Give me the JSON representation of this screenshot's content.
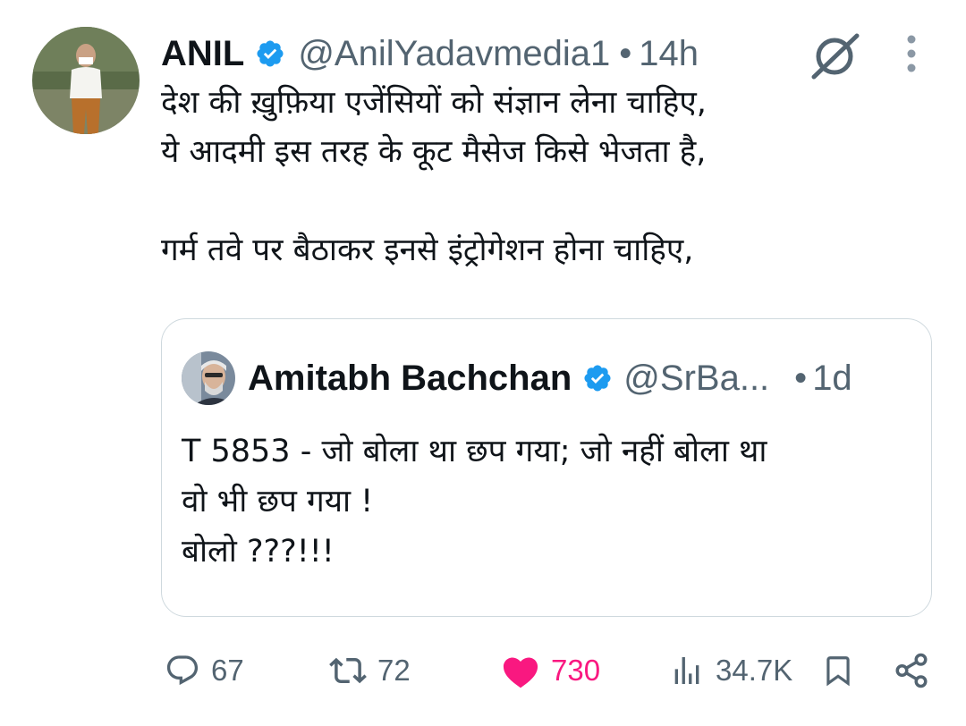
{
  "author": {
    "name": "ANIL",
    "handle": "@AnilYadavmedia1",
    "separator": "•",
    "time": "14h",
    "verified": true
  },
  "tweet_lines": [
    "देश की ख़ुफ़िया एजेंसियों को संज्ञान लेना चाहिए,",
    "ये आदमी इस तरह के कूट मैसेज किसे भेजता है,",
    "गर्म तवे पर बैठाकर इनसे इंट्रोगेशन होना चाहिए,"
  ],
  "quoted_tweet": {
    "name": "Amitabh Bachchan",
    "handle": "@SrBa...",
    "separator": "•",
    "time": "1d",
    "verified": true,
    "lines": [
      "T 5853 - जो बोला था छप गया; जो नहीं बोला था",
      "वो भी छप गया  !",
      "बोलो  ???!!!"
    ]
  },
  "actions": {
    "replies": "67",
    "reposts": "72",
    "likes": "730",
    "views": "34.7K",
    "liked": true
  },
  "icons": {
    "verified": "verified-badge-icon",
    "grok": "grok-icon",
    "more": "more-vertical-icon",
    "reply": "reply-icon",
    "repost": "repost-icon",
    "like": "heart-icon",
    "views": "views-icon",
    "bookmark": "bookmark-icon",
    "share": "share-icon"
  },
  "colors": {
    "text": "#0f1419",
    "secondary": "#536471",
    "verified": "#1d9bf0",
    "like": "#f91880",
    "border": "#cfd9de"
  }
}
